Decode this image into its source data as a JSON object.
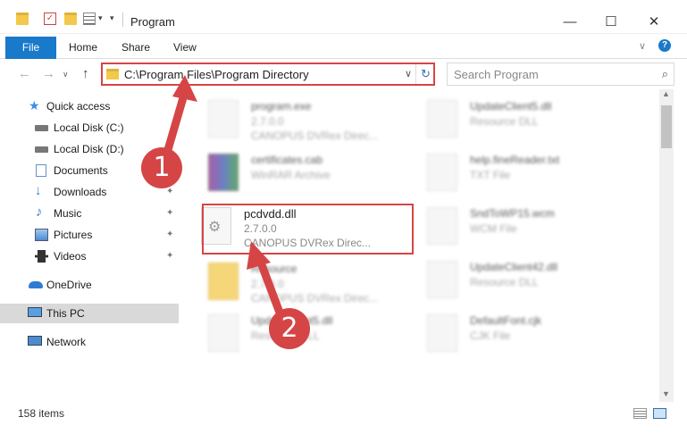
{
  "window": {
    "title": "Program",
    "minimize": "—",
    "maximize": "☐",
    "close": "✕"
  },
  "ribbon": {
    "tabs": [
      "File",
      "Home",
      "Share",
      "View"
    ],
    "expand": "∨",
    "help": "?"
  },
  "nav": {
    "back": "←",
    "forward": "→",
    "recent": "∨",
    "up": "↑",
    "address": "C:\\Program Files\\Program Directory",
    "address_dropdown": "∨",
    "refresh": "↻",
    "search_placeholder": "Search Program",
    "search_icon": "⌕"
  },
  "sidebar": {
    "items": [
      {
        "label": "Quick access",
        "icon": "star-icon"
      },
      {
        "label": "Local Disk (C:)",
        "icon": "drive-icon"
      },
      {
        "label": "Local Disk (D:)",
        "icon": "drive-icon"
      },
      {
        "label": "Documents",
        "icon": "documents-icon"
      },
      {
        "label": "Downloads",
        "icon": "download-icon"
      },
      {
        "label": "Music",
        "icon": "music-icon"
      },
      {
        "label": "Pictures",
        "icon": "pictures-icon"
      },
      {
        "label": "Videos",
        "icon": "videos-icon"
      },
      {
        "label": "OneDrive",
        "icon": "cloud-icon"
      },
      {
        "label": "This PC",
        "icon": "computer-icon"
      },
      {
        "label": "Network",
        "icon": "network-icon"
      }
    ],
    "pin": "📌"
  },
  "files": {
    "col1": [
      {
        "name": "program.exe",
        "line2": "2.7.0.0",
        "line3": "CANOPUS DVRex Direc..."
      },
      {
        "name": "certificates.cab",
        "line2": "WinRAR Archive",
        "line3": ""
      },
      {
        "name": "pcdvdd.dll",
        "line2": "2.7.0.0",
        "line3": "CANOPUS DVRex Direc..."
      },
      {
        "name": "Resource",
        "line2": "2.7.0.0",
        "line3": "CANOPUS DVRex Direc..."
      },
      {
        "name": "UpdateClient5.dll",
        "line2": "Resource DLL",
        "line3": ""
      }
    ],
    "col2": [
      {
        "name": "UpdateClient5.dll",
        "line2": "Resource DLL"
      },
      {
        "name": "help.fineReader.txt",
        "line2": "TXT File"
      },
      {
        "name": "SndToWP15.wcm",
        "line2": "WCM File"
      },
      {
        "name": "UpdateClient42.dll",
        "line2": "Resource DLL"
      },
      {
        "name": "DefaultFont.cjk",
        "line2": "CJK File"
      }
    ]
  },
  "scrollbar": {
    "up": "▲",
    "down": "▼"
  },
  "status": {
    "count": "158 items"
  },
  "annotations": {
    "step1": "1",
    "step2": "2"
  },
  "colors": {
    "accent": "#1979ca",
    "annotation": "#d64545",
    "selected": "#d9d9d9"
  }
}
